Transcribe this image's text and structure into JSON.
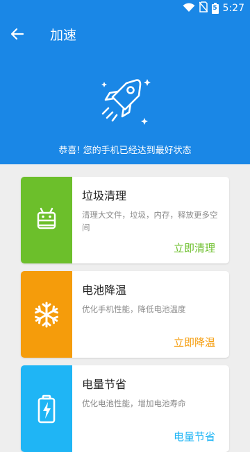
{
  "status_bar": {
    "time": "5:27",
    "battery_level": "5"
  },
  "app_bar": {
    "title": "加速"
  },
  "hero": {
    "message": "恭喜! 您的手机已经达到最好状态"
  },
  "colors": {
    "primary": "#1a87e6",
    "green": "#6cbf2b",
    "orange": "#f59c0b",
    "cyan": "#1fb5f5"
  },
  "cards": [
    {
      "title": "垃圾清理",
      "desc": "清理大文件，垃圾，内存，释放更多空间",
      "action": "立即清理",
      "icon": "android-icon"
    },
    {
      "title": "电池降温",
      "desc": "优化手机性能，降低电池温度",
      "action": "立即降温",
      "icon": "snowflake-icon"
    },
    {
      "title": "电量节省",
      "desc": "优化电池性能，增加电池寿命",
      "action": "电量节省",
      "icon": "battery-charging-icon"
    }
  ]
}
